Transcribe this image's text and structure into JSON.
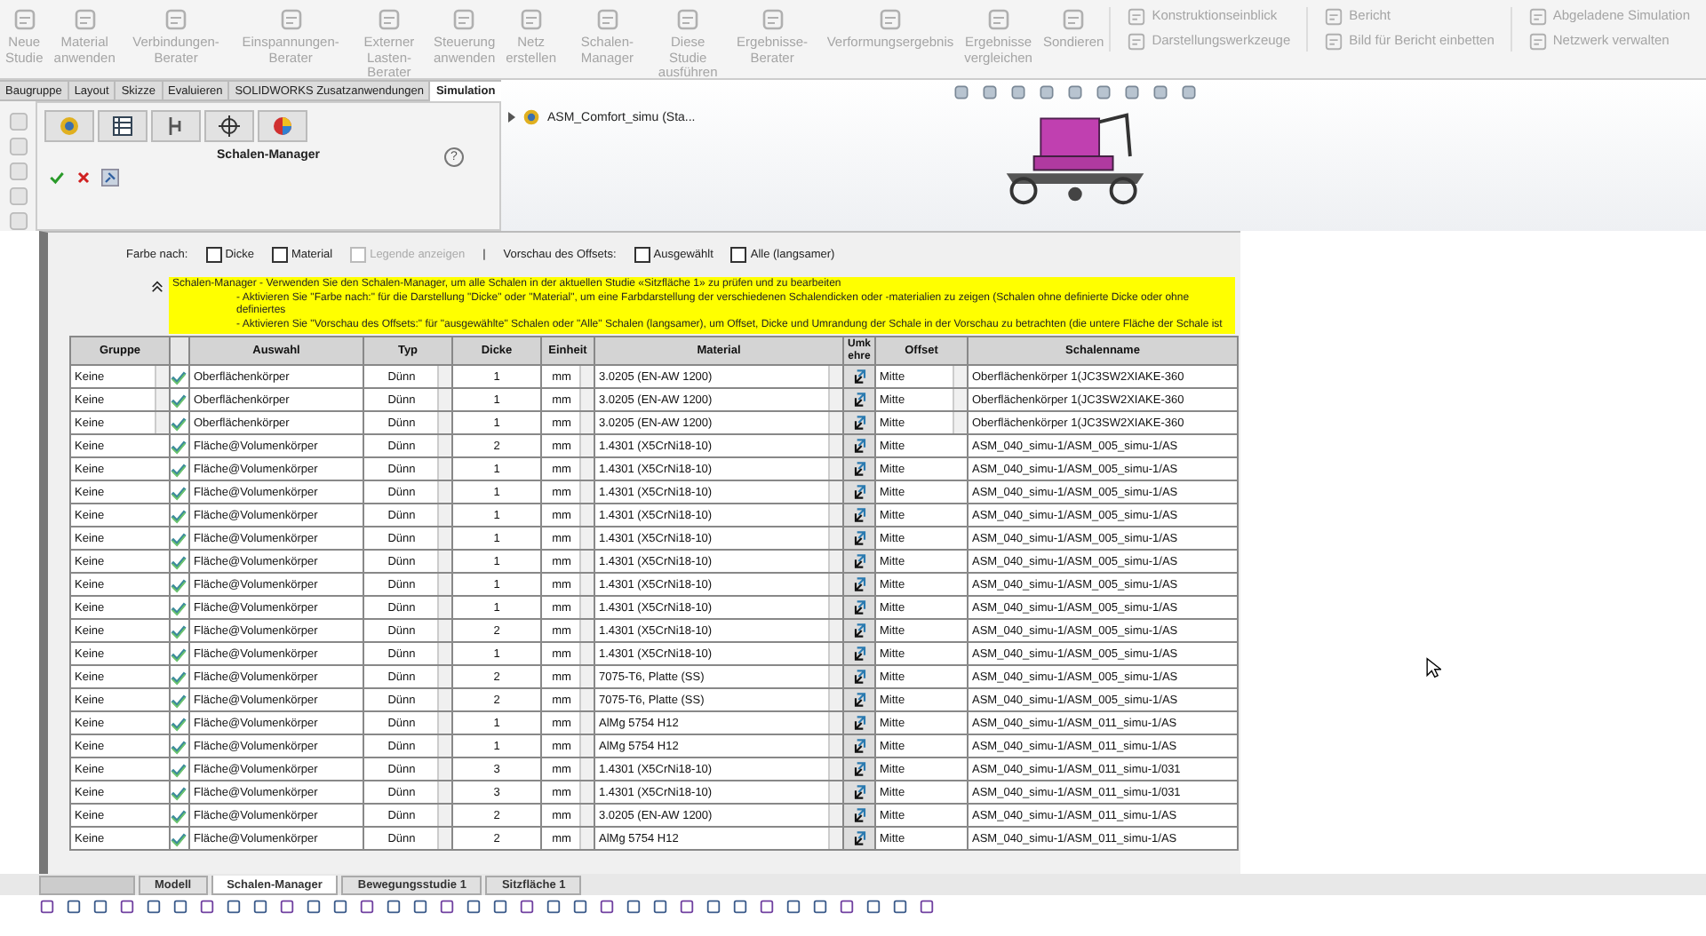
{
  "ribbon": {
    "groups": [
      {
        "kind": "large",
        "label": "Neue\nStudie",
        "disabled": true
      },
      {
        "kind": "large",
        "label": "Material\nanwenden",
        "disabled": true
      },
      {
        "kind": "large",
        "label": "Verbindungen-Berater",
        "disabled": true
      },
      {
        "kind": "large",
        "label": "Einspannungen-Berater",
        "disabled": true
      },
      {
        "kind": "large",
        "label": "Externer\nLasten-Berater",
        "disabled": true
      },
      {
        "kind": "large",
        "label": "Steuerung\nanwenden",
        "disabled": true
      },
      {
        "kind": "large",
        "label": "Netz\nerstellen",
        "disabled": true
      },
      {
        "kind": "large",
        "label": "Schalen-Manager",
        "disabled": true
      },
      {
        "kind": "large",
        "label": "Diese Studie\nausführen",
        "disabled": true
      },
      {
        "kind": "large",
        "label": "Ergebnisse-Berater",
        "disabled": true
      },
      {
        "kind": "large",
        "label": "Verformungsergebnis",
        "disabled": true
      },
      {
        "kind": "large",
        "label": "Ergebnisse\nvergleichen",
        "disabled": true
      },
      {
        "kind": "large",
        "label": "Sondieren",
        "disabled": true
      },
      {
        "kind": "stack",
        "items": [
          {
            "label": "Konstruktionseinblick",
            "disabled": true
          },
          {
            "label": "Darstellungswerkzeuge",
            "disabled": true
          }
        ]
      },
      {
        "kind": "stack",
        "items": [
          {
            "label": "Bericht",
            "disabled": true
          },
          {
            "label": "Bild für Bericht einbetten",
            "disabled": true
          }
        ]
      },
      {
        "kind": "stack",
        "items": [
          {
            "label": "Abgeladene Simulation",
            "disabled": true
          },
          {
            "label": "Netzwerk verwalten",
            "disabled": true
          }
        ]
      }
    ]
  },
  "ribbon_tabs": [
    {
      "label": "Baugruppe",
      "selected": false
    },
    {
      "label": "Layout",
      "selected": false
    },
    {
      "label": "Skizze",
      "selected": false
    },
    {
      "label": "Evaluieren",
      "selected": false
    },
    {
      "label": "SOLIDWORKS Zusatzanwendungen",
      "selected": false
    },
    {
      "label": "Simulation",
      "selected": true
    }
  ],
  "property_manager": {
    "title": "Schalen-Manager",
    "help": "?"
  },
  "feature_tree": {
    "items": [
      {
        "label": "ASM_Comfort_simu (Sta..."
      }
    ]
  },
  "options": {
    "color_by_label": "Farbe nach:",
    "color_by": [
      {
        "label": "Dicke",
        "checked": false
      },
      {
        "label": "Material",
        "checked": false
      }
    ],
    "legend": {
      "label": "Legende anzeigen",
      "checked": false,
      "disabled": true
    },
    "separator": "|",
    "offset_label": "Vorschau des Offsets:",
    "offset_preview": [
      {
        "label": "Ausgewählt",
        "checked": false
      },
      {
        "label": "Alle (langsamer)",
        "checked": false
      }
    ]
  },
  "info": {
    "lines": [
      "Schalen-Manager - Verwenden Sie den Schalen-Manager, um alle Schalen in der aktuellen Studie «Sitzfläche 1» zu prüfen und zu bearbeiten",
      "- Aktivieren Sie \"Farbe nach:\" für die Darstellung \"Dicke\" oder \"Material\", um eine Farbdarstellung der verschiedenen Schalendicken oder -materialien zu zeigen (Schalen ohne definierte Dicke oder ohne definiertes",
      "- Aktivieren Sie \"Vorschau des Offsets:\" für \"ausgewählte\" Schalen oder \"Alle\" Schalen (langsamer), um Offset, Dicke und Umrandung der Schale in der Vorschau zu betrachten (die untere Fläche der Schale ist"
    ]
  },
  "table": {
    "columns": [
      "Gruppe",
      "Auswahl",
      "Typ",
      "Dicke",
      "Einheit",
      "Material",
      "Umk ehre",
      "Offset",
      "Schalenname"
    ],
    "rows": [
      {
        "kind": "body",
        "group": "Keine",
        "selection": "Oberflächenkörper",
        "type": "Dünn",
        "thickness": "1",
        "unit": "mm",
        "material": "3.0205 (EN-AW 1200)",
        "offset": "Mitte",
        "name": "Oberflächenkörper 1(JC3SW2XIAKE-360"
      },
      {
        "kind": "body",
        "group": "Keine",
        "selection": "Oberflächenkörper",
        "type": "Dünn",
        "thickness": "1",
        "unit": "mm",
        "material": "3.0205 (EN-AW 1200)",
        "offset": "Mitte",
        "name": "Oberflächenkörper 1(JC3SW2XIAKE-360"
      },
      {
        "kind": "body",
        "group": "Keine",
        "selection": "Oberflächenkörper",
        "type": "Dünn",
        "thickness": "1",
        "unit": "mm",
        "material": "3.0205 (EN-AW 1200)",
        "offset": "Mitte",
        "name": "Oberflächenkörper 1(JC3SW2XIAKE-360"
      },
      {
        "kind": "face",
        "group": "Keine",
        "selection": "Fläche@Volumenkörper",
        "type": "Dünn",
        "thickness": "2",
        "unit": "mm",
        "material": "1.4301 (X5CrNi18-10)",
        "offset": "Mitte",
        "name": "ASM_040_simu-1/ASM_005_simu-1/AS"
      },
      {
        "kind": "face",
        "group": "Keine",
        "selection": "Fläche@Volumenkörper",
        "type": "Dünn",
        "thickness": "1",
        "unit": "mm",
        "material": "1.4301 (X5CrNi18-10)",
        "offset": "Mitte",
        "name": "ASM_040_simu-1/ASM_005_simu-1/AS"
      },
      {
        "kind": "face",
        "group": "Keine",
        "selection": "Fläche@Volumenkörper",
        "type": "Dünn",
        "thickness": "1",
        "unit": "mm",
        "material": "1.4301 (X5CrNi18-10)",
        "offset": "Mitte",
        "name": "ASM_040_simu-1/ASM_005_simu-1/AS"
      },
      {
        "kind": "face",
        "group": "Keine",
        "selection": "Fläche@Volumenkörper",
        "type": "Dünn",
        "thickness": "1",
        "unit": "mm",
        "material": "1.4301 (X5CrNi18-10)",
        "offset": "Mitte",
        "name": "ASM_040_simu-1/ASM_005_simu-1/AS"
      },
      {
        "kind": "face",
        "group": "Keine",
        "selection": "Fläche@Volumenkörper",
        "type": "Dünn",
        "thickness": "1",
        "unit": "mm",
        "material": "1.4301 (X5CrNi18-10)",
        "offset": "Mitte",
        "name": "ASM_040_simu-1/ASM_005_simu-1/AS"
      },
      {
        "kind": "face",
        "group": "Keine",
        "selection": "Fläche@Volumenkörper",
        "type": "Dünn",
        "thickness": "1",
        "unit": "mm",
        "material": "1.4301 (X5CrNi18-10)",
        "offset": "Mitte",
        "name": "ASM_040_simu-1/ASM_005_simu-1/AS"
      },
      {
        "kind": "face",
        "group": "Keine",
        "selection": "Fläche@Volumenkörper",
        "type": "Dünn",
        "thickness": "1",
        "unit": "mm",
        "material": "1.4301 (X5CrNi18-10)",
        "offset": "Mitte",
        "name": "ASM_040_simu-1/ASM_005_simu-1/AS"
      },
      {
        "kind": "face",
        "group": "Keine",
        "selection": "Fläche@Volumenkörper",
        "type": "Dünn",
        "thickness": "1",
        "unit": "mm",
        "material": "1.4301 (X5CrNi18-10)",
        "offset": "Mitte",
        "name": "ASM_040_simu-1/ASM_005_simu-1/AS"
      },
      {
        "kind": "face",
        "group": "Keine",
        "selection": "Fläche@Volumenkörper",
        "type": "Dünn",
        "thickness": "2",
        "unit": "mm",
        "material": "1.4301 (X5CrNi18-10)",
        "offset": "Mitte",
        "name": "ASM_040_simu-1/ASM_005_simu-1/AS"
      },
      {
        "kind": "face",
        "group": "Keine",
        "selection": "Fläche@Volumenkörper",
        "type": "Dünn",
        "thickness": "1",
        "unit": "mm",
        "material": "1.4301 (X5CrNi18-10)",
        "offset": "Mitte",
        "name": "ASM_040_simu-1/ASM_005_simu-1/AS"
      },
      {
        "kind": "face",
        "group": "Keine",
        "selection": "Fläche@Volumenkörper",
        "type": "Dünn",
        "thickness": "2",
        "unit": "mm",
        "material": "7075-T6, Platte (SS)",
        "offset": "Mitte",
        "name": "ASM_040_simu-1/ASM_005_simu-1/AS"
      },
      {
        "kind": "face",
        "group": "Keine",
        "selection": "Fläche@Volumenkörper",
        "type": "Dünn",
        "thickness": "2",
        "unit": "mm",
        "material": "7075-T6, Platte (SS)",
        "offset": "Mitte",
        "name": "ASM_040_simu-1/ASM_005_simu-1/AS"
      },
      {
        "kind": "face",
        "group": "Keine",
        "selection": "Fläche@Volumenkörper",
        "type": "Dünn",
        "thickness": "1",
        "unit": "mm",
        "material": "AlMg 5754 H12",
        "offset": "Mitte",
        "name": "ASM_040_simu-1/ASM_011_simu-1/AS"
      },
      {
        "kind": "face",
        "group": "Keine",
        "selection": "Fläche@Volumenkörper",
        "type": "Dünn",
        "thickness": "1",
        "unit": "mm",
        "material": "AlMg 5754 H12",
        "offset": "Mitte",
        "name": "ASM_040_simu-1/ASM_011_simu-1/AS"
      },
      {
        "kind": "face",
        "group": "Keine",
        "selection": "Fläche@Volumenkörper",
        "type": "Dünn",
        "thickness": "3",
        "unit": "mm",
        "material": "1.4301 (X5CrNi18-10)",
        "offset": "Mitte",
        "name": "ASM_040_simu-1/ASM_011_simu-1/031"
      },
      {
        "kind": "face",
        "group": "Keine",
        "selection": "Fläche@Volumenkörper",
        "type": "Dünn",
        "thickness": "3",
        "unit": "mm",
        "material": "1.4301 (X5CrNi18-10)",
        "offset": "Mitte",
        "name": "ASM_040_simu-1/ASM_011_simu-1/031"
      },
      {
        "kind": "face",
        "group": "Keine",
        "selection": "Fläche@Volumenkörper",
        "type": "Dünn",
        "thickness": "2",
        "unit": "mm",
        "material": "3.0205 (EN-AW 1200)",
        "offset": "Mitte",
        "name": "ASM_040_simu-1/ASM_011_simu-1/AS"
      },
      {
        "kind": "face",
        "group": "Keine",
        "selection": "Fläche@Volumenkörper",
        "type": "Dünn",
        "thickness": "2",
        "unit": "mm",
        "material": "AlMg 5754 H12",
        "offset": "Mitte",
        "name": "ASM_040_simu-1/ASM_011_simu-1/AS"
      }
    ]
  },
  "bottom_tabs": [
    {
      "label": "Modell",
      "selected": false
    },
    {
      "label": "Schalen-Manager",
      "selected": true
    },
    {
      "label": "Bewegungsstudie 1",
      "selected": false
    },
    {
      "label": "Sitzfläche 1",
      "selected": false
    }
  ]
}
